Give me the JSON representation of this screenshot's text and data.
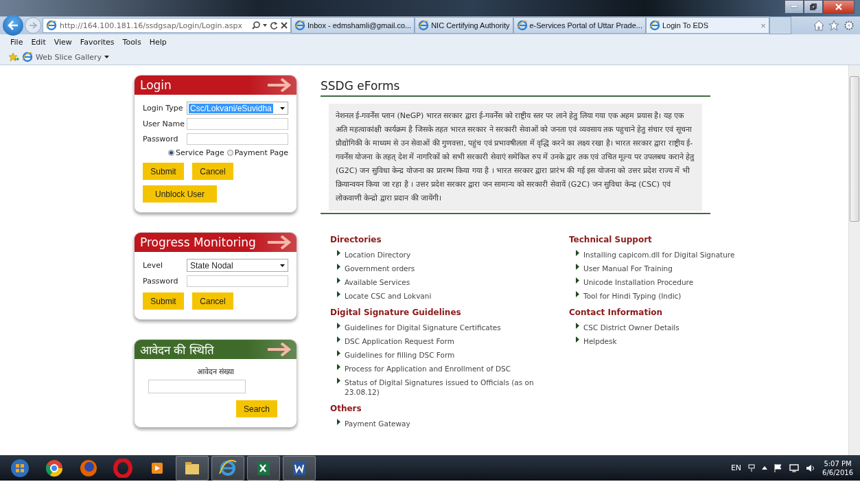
{
  "browser": {
    "address": "http://164.100.181.16/ssdgsap/Login/Login.aspx",
    "tabs": [
      {
        "label": "Inbox - edmshamli@gmail.co...",
        "selected": false
      },
      {
        "label": "NIC Certifying Authority",
        "selected": false
      },
      {
        "label": "e-Services Portal of Uttar Prade...",
        "selected": false
      },
      {
        "label": "Login To EDS",
        "selected": true
      }
    ],
    "tab_close": "×",
    "menu": [
      "File",
      "Edit",
      "View",
      "Favorites",
      "Tools",
      "Help"
    ],
    "favorites": [
      "Web Slice Gallery"
    ]
  },
  "panels": [
    {
      "title": "Login",
      "color": "#c0161e",
      "rows": [
        {
          "kind": "select",
          "label": "Login Type",
          "value": "Csc/Lokvani/eSuvidha",
          "highlighted": true
        },
        {
          "kind": "text",
          "label": "User Name"
        },
        {
          "kind": "text",
          "label": "Password"
        },
        {
          "kind": "radios",
          "options": [
            {
              "label": "Service Page",
              "selected": true
            },
            {
              "label": "Payment Page",
              "selected": false
            }
          ]
        },
        {
          "kind": "buttons",
          "buttons": [
            "Submit",
            "Cancel"
          ]
        },
        {
          "kind": "buttons",
          "buttons": [
            "Unblock User"
          ]
        }
      ]
    },
    {
      "title": "Progress Monitoring",
      "color": "#c0161e",
      "rows": [
        {
          "kind": "select",
          "label": "Level",
          "value": "State Nodal",
          "highlighted": false
        },
        {
          "kind": "text",
          "label": "Password"
        },
        {
          "kind": "buttons",
          "buttons": [
            "Submit",
            "Cancel"
          ]
        }
      ]
    },
    {
      "title": "आवेदन की स्थिति",
      "color": "#3f6b2a",
      "rows": [
        {
          "kind": "caption",
          "label": "आवेदन संख्या"
        },
        {
          "kind": "search",
          "button": "Search"
        }
      ]
    }
  ],
  "content": {
    "title": "SSDG eForms",
    "intro": "नेशनल ई-गवर्नेंस प्लान (NeGP) भारत सरकार द्वारा ई-गवर्नेंस को राष्ट्रीय स्तर पर लाने हेतु लिया गया एक अहम प्रयास है। यह एक अति महत्वाकांक्षी कार्यक्रम है जिसके तहत भारत सरकार ने सरकारी सेवाओं को जनता एवं व्यवसाय तक पहुचाने हेतु संचार एवं सूचना प्रौद्योगिकी के माध्यम से उन सेवाओं की गुणवत्ता, पहुंच एवं प्रभावषीलता में वृद्धि करने का लक्ष्य रखा है। भारत सरकार द्वारा राष्ट्रीय ई-गवर्नेंस योजना के तहत् देश में नागरिकों को सभी सरकारी सेवाएं समेकित रुप में उनके द्वार तक एवं उचित मूल्य पर उपलबध कराने हेतु (G2C) जन सुविधा केन्द्र योजना का प्रारम्भ किया गया है । भारत सरकार द्वारा प्रारंभ की गई इस योजना को उत्तर प्रदेश राज्य में भी क्रियान्वयन किया जा रहा है । उत्तर प्रदेश सरकार द्वारा जन सामान्य को सरकारी सेवायें (G2C) जन सुविधा केन्द्र (CSC) एवं लोकवाणी केन्द्रो द्वारा प्रदान की जायेंगी।",
    "columns": [
      [
        {
          "heading": "Directories",
          "links": [
            "Location Directory",
            "Government orders",
            "Available Services",
            "Locate CSC and Lokvani"
          ]
        },
        {
          "heading": "Digital Signature Guidelines",
          "links": [
            "Guidelines for Digital Signature Certificates",
            "DSC Application Request Form",
            "Guidelines for filling DSC Form",
            "Process for Application and Enrollment of DSC",
            "Status of Digital Signatures issued to Officials (as on 23.08.12)"
          ]
        },
        {
          "heading": "Others",
          "links": [
            "Payment Gateway"
          ]
        }
      ],
      [
        {
          "heading": "Technical Support",
          "links": [
            "Installing capicom.dll for Digital Signature",
            "User Manual For Training",
            "Unicode Installation Procedure",
            "Tool for Hindi Typing (Indic)"
          ]
        },
        {
          "heading": "Contact Information",
          "links": [
            "CSC District Owner Details",
            "Helpdesk"
          ]
        }
      ]
    ]
  },
  "taskbar": {
    "language": "EN",
    "time": "5:07 PM",
    "date": "6/6/2016"
  }
}
